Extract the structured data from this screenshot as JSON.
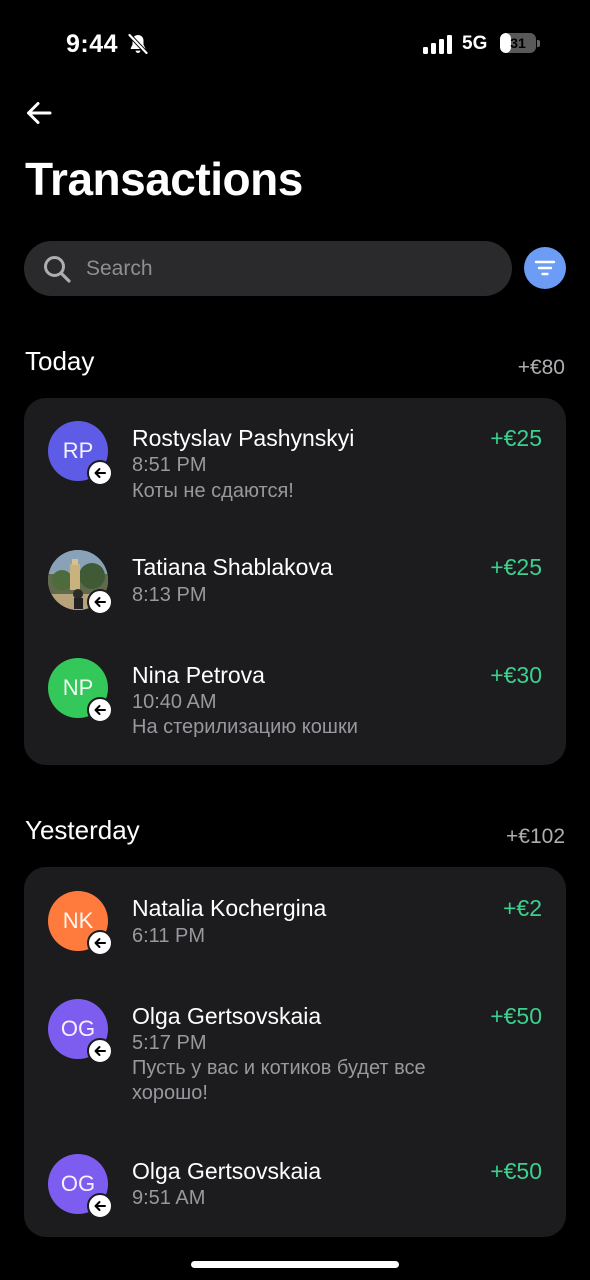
{
  "status_bar": {
    "time": "9:44",
    "network": "5G",
    "battery": "31",
    "battery_level": 0.31
  },
  "header": {
    "title": "Transactions"
  },
  "search": {
    "placeholder": "Search"
  },
  "sections": [
    {
      "title": "Today",
      "total": "+€80",
      "transactions": [
        {
          "initials": "RP",
          "avatar_color": "#5e5ce6",
          "name": "Rostyslav Pashynskyi",
          "time": "8:51 PM",
          "note": "Коты не сдаются!",
          "amount": "+€25"
        },
        {
          "initials": "",
          "avatar_color": "#6b7a5a",
          "name": "Tatiana Shablakova",
          "time": "8:13 PM",
          "note": "",
          "amount": "+€25"
        },
        {
          "initials": "NP",
          "avatar_color": "#34c759",
          "name": "Nina Petrova",
          "time": "10:40 AM",
          "note": "На стерилизацию кошки",
          "amount": "+€30"
        }
      ]
    },
    {
      "title": "Yesterday",
      "total": "+€102",
      "transactions": [
        {
          "initials": "NK",
          "avatar_color": "#ff7a3d",
          "name": "Natalia Kochergina",
          "time": "6:11 PM",
          "note": "",
          "amount": "+€2"
        },
        {
          "initials": "OG",
          "avatar_color": "#7d5cf0",
          "name": "Olga Gertsovskaia",
          "time": "5:17 PM",
          "note": "Пусть у вас и котиков будет все хорошо!",
          "amount": "+€50"
        },
        {
          "initials": "OG",
          "avatar_color": "#7d5cf0",
          "name": "Olga Gertsovskaia",
          "time": "9:51 AM",
          "note": "",
          "amount": "+€50"
        }
      ]
    }
  ],
  "colors": {
    "background": "#000000",
    "card": "#1c1c1e",
    "positive_amount": "#3ccf8e",
    "filter_button": "#6c9cf5"
  },
  "icons": {
    "back": "arrow-left-icon",
    "search": "search-icon",
    "filter": "filter-icon",
    "incoming": "incoming-arrow-icon",
    "bell_muted": "bell-muted-icon"
  }
}
